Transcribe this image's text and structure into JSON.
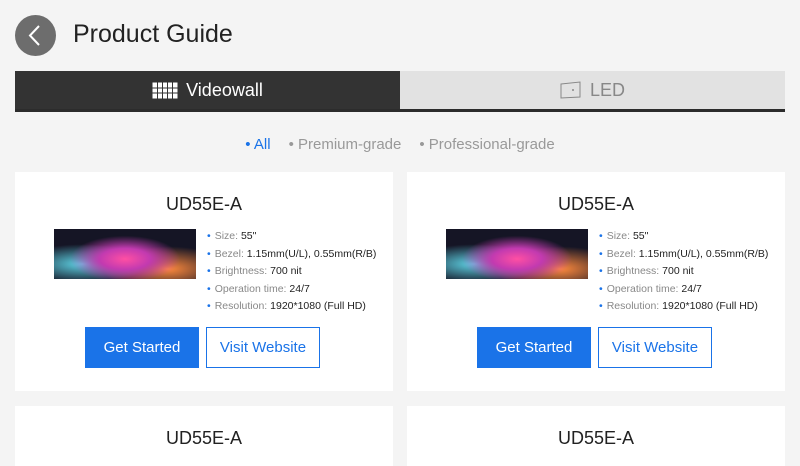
{
  "header": {
    "title": "Product Guide"
  },
  "tabs": [
    {
      "label": "Videowall",
      "icon": "grid-icon"
    },
    {
      "label": "LED",
      "icon": "led-panel-icon"
    }
  ],
  "filters": [
    "All",
    "Premium-grade",
    "Professional-grade"
  ],
  "products": [
    {
      "name": "UD55E-A",
      "specs": [
        [
          "Size:",
          "55\""
        ],
        [
          "Bezel:",
          "1.15mm(U/L), 0.55mm(R/B)"
        ],
        [
          "Brightness:",
          "700 nit"
        ],
        [
          "Operation time:",
          "24/7"
        ],
        [
          "Resolution:",
          "1920*1080 (Full HD)"
        ]
      ],
      "primary": "Get Started",
      "secondary": "Visit Website"
    },
    {
      "name": "UD55E-A",
      "specs": [
        [
          "Size:",
          "55\""
        ],
        [
          "Bezel:",
          "1.15mm(U/L), 0.55mm(R/B)"
        ],
        [
          "Brightness:",
          "700 nit"
        ],
        [
          "Operation time:",
          "24/7"
        ],
        [
          "Resolution:",
          "1920*1080 (Full HD)"
        ]
      ],
      "primary": "Get Started",
      "secondary": "Visit Website"
    },
    {
      "name": "UD55E-A"
    },
    {
      "name": "UD55E-A"
    }
  ]
}
